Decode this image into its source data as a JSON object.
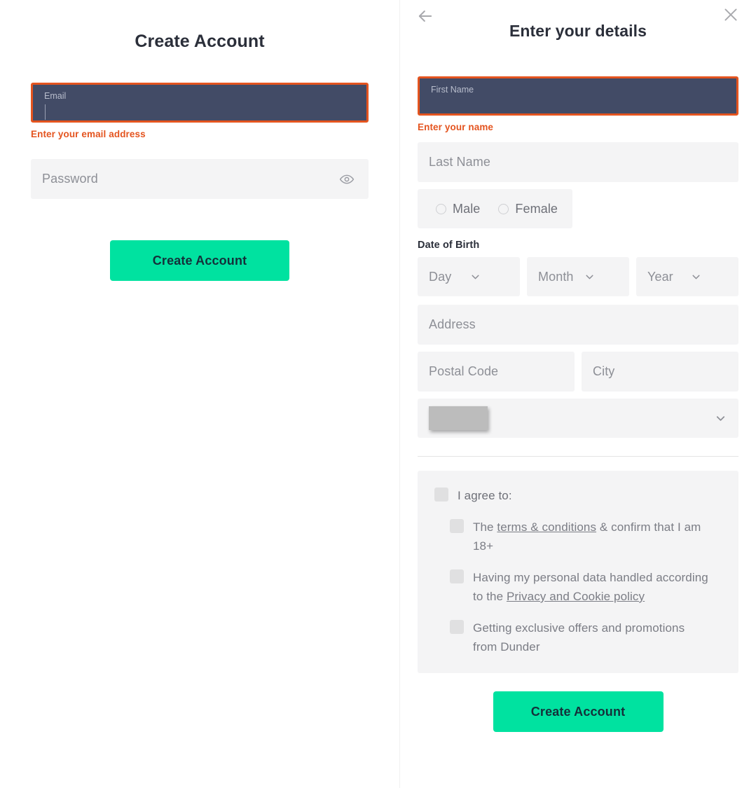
{
  "left_panel": {
    "title": "Create Account",
    "email_field": {
      "label": "Email",
      "value": "",
      "error": "Enter your email address"
    },
    "password_field": {
      "placeholder": "Password",
      "value": "",
      "toggle_icon": "eye-icon"
    },
    "submit_label": "Create Account"
  },
  "right_panel": {
    "title": "Enter your details",
    "back_icon": "arrow-left-icon",
    "close_icon": "close-icon",
    "first_name": {
      "label": "First Name",
      "value": "",
      "error": "Enter your name"
    },
    "last_name": {
      "placeholder": "Last Name",
      "value": ""
    },
    "gender": {
      "options": [
        {
          "label": "Male",
          "selected": false
        },
        {
          "label": "Female",
          "selected": false
        }
      ]
    },
    "date_of_birth": {
      "label": "Date of Birth",
      "day": "Day",
      "month": "Month",
      "year": "Year"
    },
    "address": {
      "placeholder": "Address",
      "value": ""
    },
    "postal_code": {
      "placeholder": "Postal Code",
      "value": ""
    },
    "city": {
      "placeholder": "City",
      "value": ""
    },
    "country_select": {
      "value": "",
      "flag_icon": "flag-image-placeholder",
      "chevron_icon": "chevron-down-icon"
    },
    "consent": {
      "heading": "I agree to:",
      "items": [
        {
          "prefix": "The ",
          "link": "terms & conditions",
          "suffix": " & confirm that I am 18+"
        },
        {
          "prefix": "Having my personal data handled according to the ",
          "link": "Privacy and Cookie policy",
          "suffix": ""
        },
        {
          "prefix": "Getting exclusive offers and promotions from Dunder",
          "link": "",
          "suffix": ""
        }
      ]
    },
    "submit_label": "Create Account"
  },
  "colors": {
    "accent_green": "#00E2A0",
    "error_orange": "#E4541F",
    "focused_field_bg": "#424B66",
    "field_bg": "#F4F4F5",
    "text_dark": "#2B2F3A",
    "text_muted": "#8D8F96"
  }
}
